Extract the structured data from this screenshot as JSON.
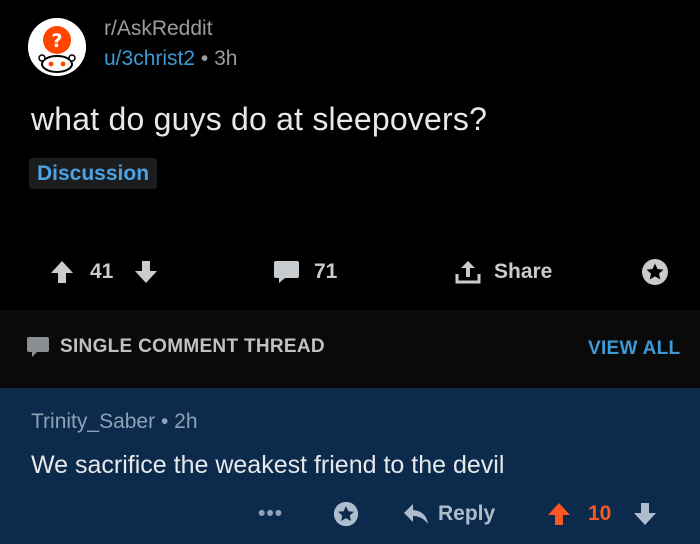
{
  "post": {
    "subreddit": "r/AskReddit",
    "author": "u/3christ2",
    "separator": "•",
    "age": "3h",
    "title": "what do guys do at sleepovers?",
    "flair": "Discussion",
    "votes": "41",
    "comments": "71",
    "share_label": "Share",
    "icons": {
      "avatar": "snoo-question-avatar-icon",
      "upvote": "arrow-up-icon",
      "downvote": "arrow-down-icon",
      "comments": "speech-bubble-icon",
      "share": "share-upload-icon",
      "award": "award-star-icon"
    }
  },
  "thread": {
    "label": "SINGLE COMMENT THREAD",
    "view_all": "VIEW ALL",
    "icon": "speech-bubble-icon"
  },
  "comment": {
    "author": "Trinity_Saber",
    "separator": "•",
    "age": "2h",
    "body": "We sacrifice the weakest friend to the devil",
    "more": "•••",
    "reply_label": "Reply",
    "votes": "10",
    "upvoted": true
  },
  "colors": {
    "background": "#000000",
    "comment_background": "#0b2a4c",
    "link_blue": "#3d9ad6",
    "upvote_orange": "#ff5722"
  }
}
